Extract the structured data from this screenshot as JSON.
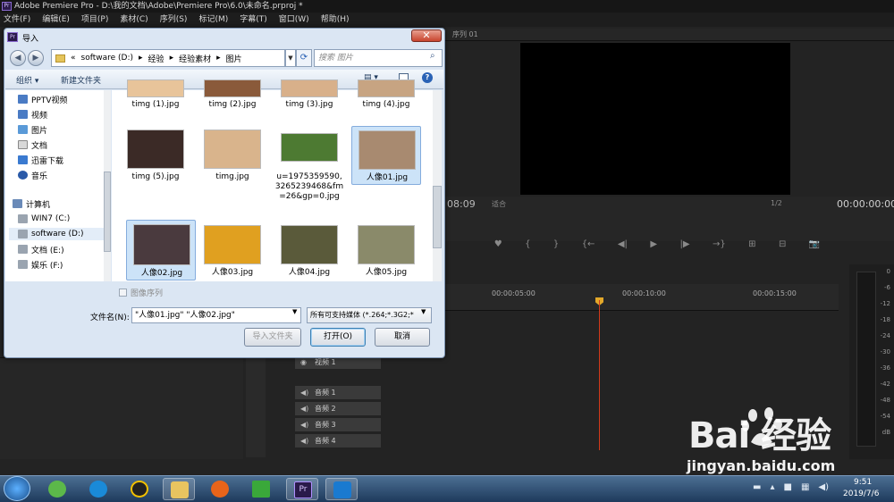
{
  "app": {
    "title": "Adobe Premiere Pro - D:\\我的文档\\Adobe\\Premiere Pro\\6.0\\未命名.prproj *",
    "logo": "Pr",
    "menu": [
      "文件(F)",
      "编辑(E)",
      "项目(P)",
      "素材(C)",
      "序列(S)",
      "标记(M)",
      "字幕(T)",
      "窗口(W)",
      "帮助(H)"
    ]
  },
  "program": {
    "tab": "序列 01",
    "timecode_left": "08:09",
    "fit": "适合",
    "quality": "1/2",
    "timecode_right": "00:00:00:00",
    "transport": [
      "♥",
      "{",
      "}",
      "{←",
      "◀|",
      "▶",
      "|▶",
      "→}",
      "⊞",
      "⊟",
      "📷"
    ]
  },
  "timeline": {
    "ruler": [
      "00:00:05:00",
      "00:00:10:00",
      "00:00:15:00"
    ],
    "tracks": [
      {
        "name": "视频 1",
        "type": "video"
      },
      {
        "name": "音频 1",
        "type": "audio"
      },
      {
        "name": "音频 2",
        "type": "audio"
      },
      {
        "name": "音频 3",
        "type": "audio"
      },
      {
        "name": "音频 4",
        "type": "audio"
      }
    ]
  },
  "meter": {
    "labels": [
      "0",
      "-6",
      "-12",
      "-18",
      "-24",
      "-30",
      "-36",
      "-42",
      "-48",
      "-54",
      "dB"
    ]
  },
  "dialog": {
    "title": "导入",
    "close": "✕",
    "address": [
      "«",
      "software (D:)",
      "▸",
      "经验",
      "▸",
      "经验素材",
      "▸",
      "图片"
    ],
    "search_placeholder": "搜索 图片",
    "toolbar": {
      "organize": "组织 ▾",
      "new_folder": "新建文件夹",
      "view": "▤ ▾"
    },
    "nav": [
      {
        "label": "PPTV视频",
        "icon": "video-folder"
      },
      {
        "label": "视频",
        "icon": "video-folder"
      },
      {
        "label": "图片",
        "icon": "picture-folder"
      },
      {
        "label": "文档",
        "icon": "document-folder"
      },
      {
        "label": "迅雷下载",
        "icon": "download-folder"
      },
      {
        "label": "音乐",
        "icon": "music-folder"
      },
      {
        "label": "计算机",
        "icon": "computer"
      },
      {
        "label": "WIN7 (C:)",
        "icon": "drive"
      },
      {
        "label": "software (D:)",
        "icon": "drive"
      },
      {
        "label": "文档 (E:)",
        "icon": "drive"
      },
      {
        "label": "娱乐 (F:)",
        "icon": "drive"
      }
    ],
    "files": [
      {
        "name": "timg (1).jpg",
        "color": "#e8c49a"
      },
      {
        "name": "timg (2).jpg",
        "color": "#8a5a3a"
      },
      {
        "name": "timg (3).jpg",
        "color": "#d8b08a"
      },
      {
        "name": "timg (4).jpg",
        "color": "#c7a482"
      },
      {
        "name": "timg (5).jpg",
        "color": "#3b2a26"
      },
      {
        "name": "timg.jpg",
        "color": "#d9b48c"
      },
      {
        "name": "u=1975359590,3265239468&fm=26&gp=0.jpg",
        "color": "#4d7a32"
      },
      {
        "name": "人像01.jpg",
        "color": "#a88a70"
      },
      {
        "name": "人像02.jpg",
        "color": "#4a3a3e"
      },
      {
        "name": "人像03.jpg",
        "color": "#e0a020"
      },
      {
        "name": "人像04.jpg",
        "color": "#5a5a3a"
      },
      {
        "name": "人像05.jpg",
        "color": "#8a8a6a"
      }
    ],
    "image_sequence": "图像序列",
    "filename_label": "文件名(N):",
    "filename_value": "\"人像01.jpg\" \"人像02.jpg\"",
    "filetype": "所有可支持媒体 (*.264;*.3G2;*",
    "btn_import_folder": "导入文件夹",
    "btn_open": "打开(O)",
    "btn_cancel": "取消"
  },
  "taskbar": {
    "time": "9:51",
    "date": "2019/7/6"
  },
  "watermark": {
    "text": "Bai  经验",
    "url": "jingyan.baidu.com"
  }
}
